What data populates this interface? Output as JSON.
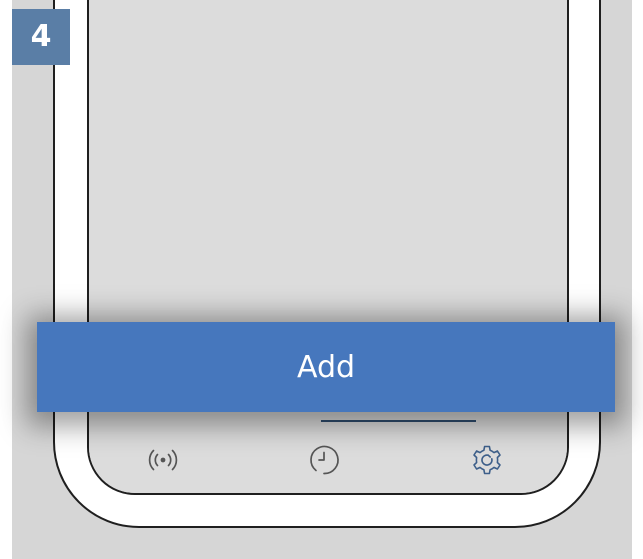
{
  "step": {
    "number": "4"
  },
  "primary_action": {
    "label": "Add"
  },
  "tab_bar": {
    "tabs": [
      {
        "icon": "signal-icon"
      },
      {
        "icon": "clock-icon"
      },
      {
        "icon": "settings-gear-icon",
        "active": true
      }
    ]
  },
  "colors": {
    "badge": "#5a7ea6",
    "button": "#4677bd",
    "background": "#d6d6d6",
    "screen": "#dcdcdc",
    "active_tab_indicator": "#2f4d6f"
  }
}
